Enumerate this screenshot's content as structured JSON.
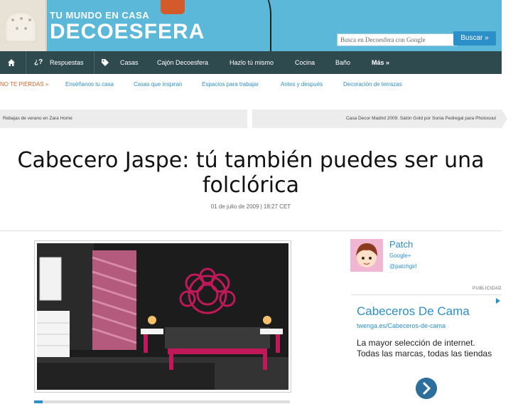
{
  "header": {
    "tagline": "TU MUNDO EN CASA",
    "logo": "DECOESFERA",
    "search_placeholder": "Busca en Decoesfera con Google",
    "search_button": "Buscar »",
    "colors": {
      "header_bg": "#5bb8d8",
      "nav_bg": "#2f4a4e",
      "link": "#2c8fc8",
      "accent": "#d0652b"
    }
  },
  "nav": {
    "home_icon": "home-icon",
    "items": [
      {
        "label": "Respuestas",
        "prefix": "¿?"
      },
      {
        "label": "Casas",
        "icon": "tag-icon"
      },
      {
        "label": "Cajón Decoesfera"
      },
      {
        "label": "Hazlo tú mismo"
      },
      {
        "label": "Cocina"
      },
      {
        "label": "Baño"
      },
      {
        "label": "Más »"
      }
    ]
  },
  "no_te_pierdas": {
    "label": "NO TE PIERDAS »",
    "links": [
      "Enséñanos tu casa",
      "Casas que inspiran",
      "Espacios para trabajar",
      "Antes y después",
      "Decoración de terrazas"
    ]
  },
  "post_nav": {
    "previous": "Rebajas de verano en Zara Home",
    "next": "Casa Decor Madrid 2009. Salón Gold por Sonia Pedregal para Photosoul"
  },
  "article": {
    "title_line1": "Cabecero Jaspe: tú también puedes ser una",
    "title_line2": "folclórica",
    "date": "01 de julio de 2009 | 18:27 CET"
  },
  "author": {
    "name": "Patch",
    "google": "Google+",
    "twitter": "@patchgirl"
  },
  "ad": {
    "label": "PUBLICIDAD",
    "title": "Cabeceros De Cama",
    "url": "twenga.es/Cabeceros-de-cama",
    "text": "La mayor selección de internet. Todas las marcas, todas las tiendas"
  }
}
